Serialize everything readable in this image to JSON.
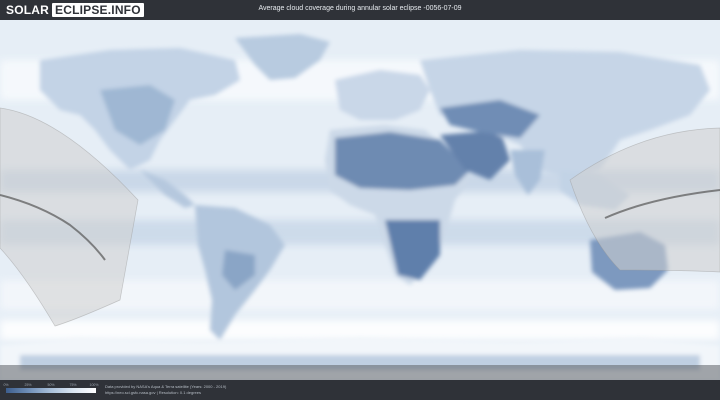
{
  "header": {
    "logo_part1": "SOLAR",
    "logo_part2": "ECLIPSE.INFO",
    "title": "Average cloud coverage during annular solar eclipse -0056-07-09"
  },
  "legend": {
    "ticks": [
      "0%",
      "25%",
      "50%",
      "75%",
      "100%"
    ],
    "colors": [
      "#3d5e8d",
      "#6f8fb8",
      "#a9c0da",
      "#dbe6f1",
      "#ffffff"
    ]
  },
  "credits": {
    "line1": "Data provided by NASA's Aqua & Terra satellite (Years: 2000 - 2019)",
    "line2": "https://neo.sci.gsfc.nasa.gov | Resolution: 0.1 degrees"
  },
  "map": {
    "ocean_color": "#e3ebf4",
    "cloudy_color": "#ffffff",
    "clear_color": "#4a6c9a",
    "eclipse_band_color": "#c9c9c9",
    "central_line_color": "#555555"
  }
}
